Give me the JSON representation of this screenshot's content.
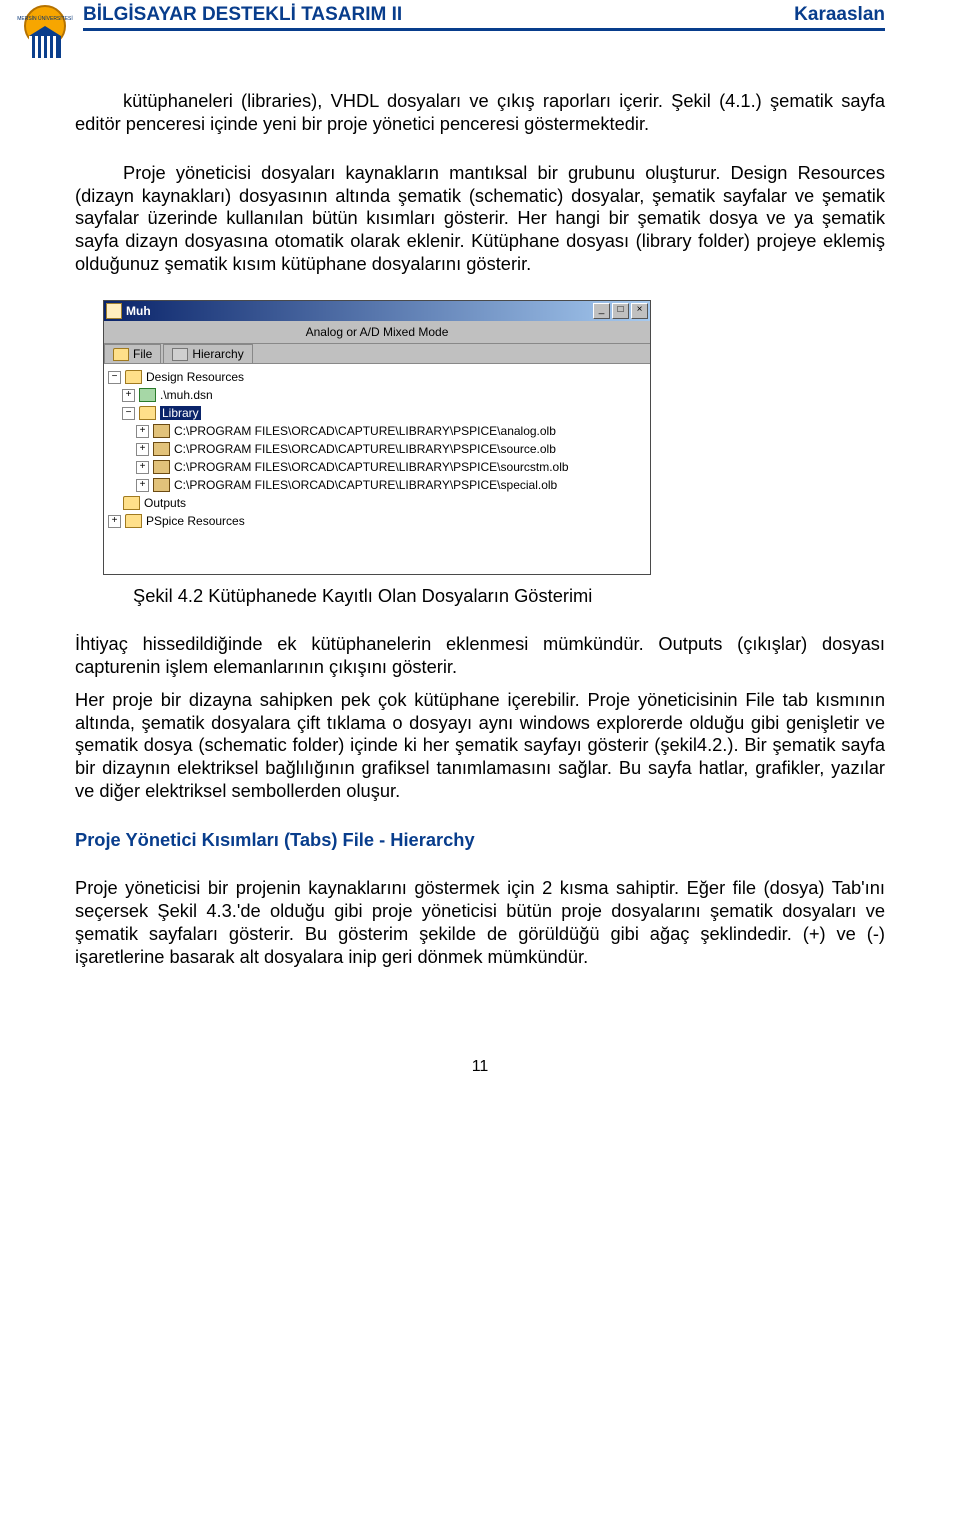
{
  "header": {
    "title": "BİLGİSAYAR DESTEKLİ TASARIM II",
    "author": "Karaaslan"
  },
  "para1": "kütüphaneleri (libraries), VHDL dosyaları ve çıkış raporları içerir. Şekil (4.1.) şematik sayfa editör penceresi içinde yeni bir proje yönetici penceresi göstermektedir.",
  "para2": "Proje yöneticisi dosyaları kaynakların mantıksal bir grubunu oluşturur. Design Resources (dizayn kaynakları) dosyasının altında şematik (schematic) dosyalar, şematik sayfalar ve şematik sayfalar üzerinde kullanılan bütün kısımları gösterir. Her hangi bir şematik dosya ve ya şematik sayfa dizayn dosyasına otomatik olarak eklenir. Kütüphane dosyası (library folder) projeye eklemiş olduğunuz şematik kısım kütüphane dosyalarını gösterir.",
  "figure": {
    "caption": "Şekil 4.2  Kütüphanede Kayıtlı Olan Dosyaların Gösterimi",
    "window": {
      "title": "Muh",
      "mode": "Analog or A/D Mixed Mode",
      "tabs": {
        "file": "File",
        "hierarchy": "Hierarchy"
      },
      "tree": {
        "root": "Design Resources",
        "dsn": ".\\muh.dsn",
        "library_label": "Library",
        "libs": [
          "C:\\PROGRAM FILES\\ORCAD\\CAPTURE\\LIBRARY\\PSPICE\\analog.olb",
          "C:\\PROGRAM FILES\\ORCAD\\CAPTURE\\LIBRARY\\PSPICE\\source.olb",
          "C:\\PROGRAM FILES\\ORCAD\\CAPTURE\\LIBRARY\\PSPICE\\sourcstm.olb",
          "C:\\PROGRAM FILES\\ORCAD\\CAPTURE\\LIBRARY\\PSPICE\\special.olb"
        ],
        "outputs": "Outputs",
        "pspice": "PSpice Resources"
      }
    }
  },
  "para3": "İhtiyaç hissedildiğinde ek kütüphanelerin eklenmesi mümkündür. Outputs (çıkışlar) dosyası capturenin işlem elemanlarının  çıkışını gösterir.",
  "para4": "Her  proje bir dizayna sahipken pek çok kütüphane içerebilir. Proje yöneticisinin File tab kısmının altında, şematik dosyalara çift tıklama o dosyayı aynı windows explorerde olduğu gibi genişletir ve şematik dosya (schematic folder) içinde ki her şematik sayfayı gösterir (şekil4.2.). Bir şematik sayfa bir dizaynın elektriksel bağlılığının grafiksel tanımlamasını sağlar. Bu sayfa hatlar, grafikler, yazılar ve diğer elektriksel sembollerden oluşur.",
  "section_heading": "Proje Yönetici Kısımları (Tabs) File - Hierarchy",
  "para5": "Proje yöneticisi bir projenin kaynaklarını göstermek için 2 kısma sahiptir. Eğer file (dosya) Tab'ını seçersek Şekil 4.3.'de olduğu gibi proje yöneticisi bütün proje dosyalarını şematik dosyaları ve şematik sayfaları gösterir. Bu gösterim şekilde de görüldüğü gibi ağaç şeklindedir. (+) ve (-) işaretlerine basarak alt dosyalara inip geri dönmek mümkündür.",
  "page_number": "11"
}
